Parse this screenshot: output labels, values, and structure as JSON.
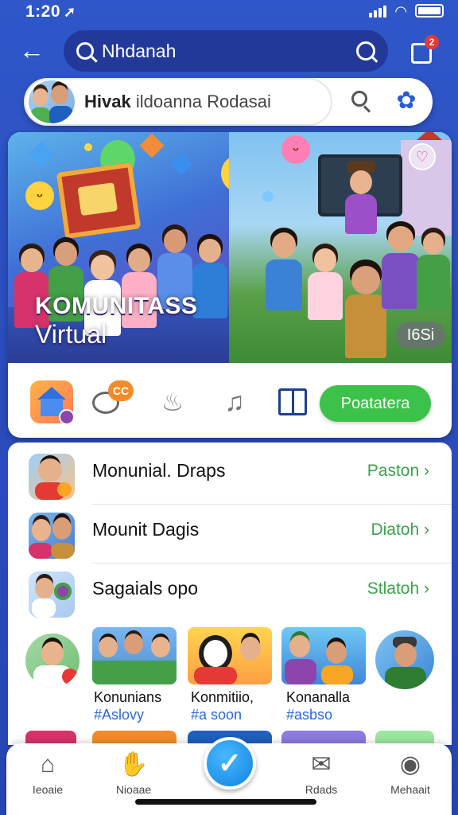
{
  "status_bar": {
    "time": "1:20",
    "arrow": "➚"
  },
  "top_bar": {
    "back_icon": "arrow-left-icon",
    "search_text": "Nhdanah",
    "compose_badge": "2"
  },
  "profile_search": {
    "name_bold": "Hivak",
    "name_rest": " ildoanna Rodasai"
  },
  "banner": {
    "title_line1": "KOMUNITASS",
    "title_line2": "Virtual",
    "live_badge": "I6Si",
    "heart": "♡"
  },
  "actions": {
    "chat_badge": "CC",
    "primary_button": "Poatatera"
  },
  "list": [
    {
      "label": "Monunial. Draps",
      "action": "Paston ›"
    },
    {
      "label": "Mounit Dagis",
      "action": "Diatoh ›"
    },
    {
      "label": "Sagaials opo",
      "action": "Stlatoh ›"
    }
  ],
  "tiles": [
    {
      "name": "Konunians",
      "tag": "#Aslovy"
    },
    {
      "name": "Konmitiio,",
      "tag": "#a soon"
    },
    {
      "name": "Konanalla",
      "tag": "#asbso"
    }
  ],
  "tabs": [
    {
      "label": "Ieoaie",
      "icon": "home-icon"
    },
    {
      "label": "Nioaae",
      "icon": "hand-icon"
    },
    {
      "label": "Rdads",
      "icon": "mail-icon"
    },
    {
      "label": "Mehaait",
      "icon": "profile-icon"
    }
  ],
  "colors": {
    "primary_blue": "#2c4fc0",
    "accent_green": "#3cc24a",
    "link_blue": "#2a6bd7"
  }
}
